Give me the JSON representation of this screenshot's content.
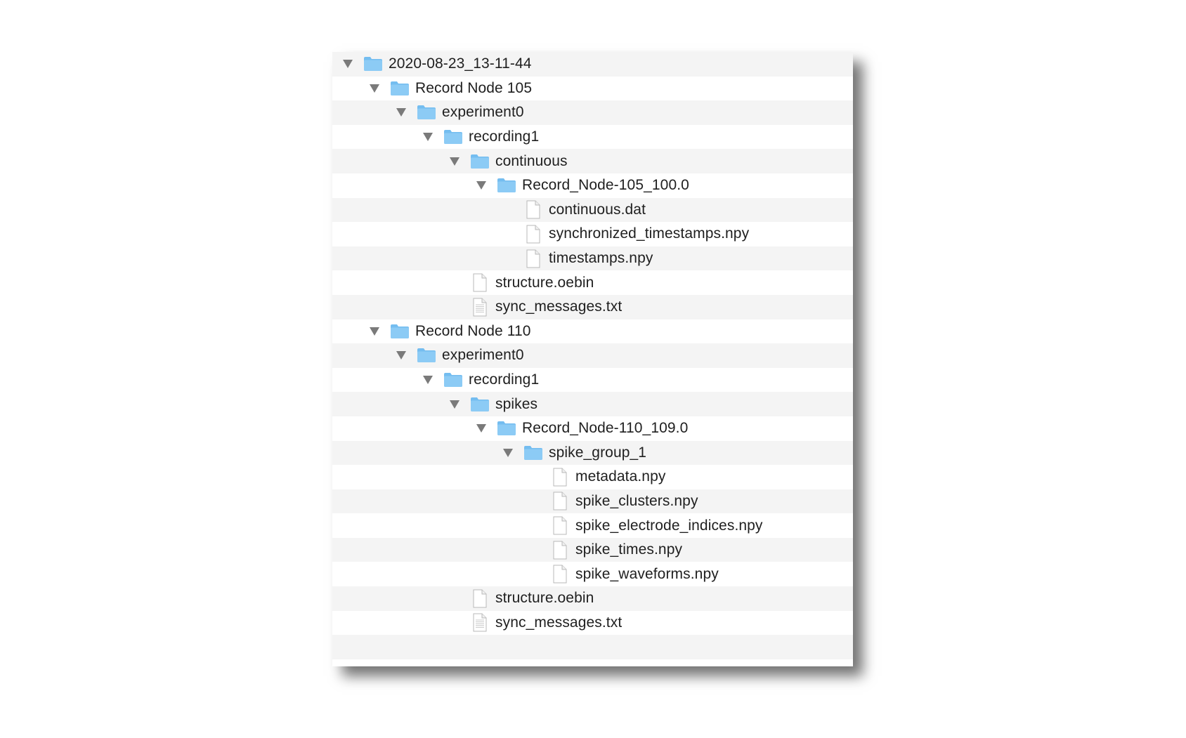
{
  "tree": {
    "rows": [
      {
        "label": "2020-08-23_13-11-44",
        "kind": "folder",
        "depth": 0,
        "expanded": true
      },
      {
        "label": "Record Node 105",
        "kind": "folder",
        "depth": 1,
        "expanded": true
      },
      {
        "label": "experiment0",
        "kind": "folder",
        "depth": 2,
        "expanded": true
      },
      {
        "label": "recording1",
        "kind": "folder",
        "depth": 3,
        "expanded": true
      },
      {
        "label": "continuous",
        "kind": "folder",
        "depth": 4,
        "expanded": true
      },
      {
        "label": "Record_Node-105_100.0",
        "kind": "folder",
        "depth": 5,
        "expanded": true
      },
      {
        "label": "continuous.dat",
        "kind": "file",
        "depth": 6
      },
      {
        "label": "synchronized_timestamps.npy",
        "kind": "file",
        "depth": 6
      },
      {
        "label": "timestamps.npy",
        "kind": "file",
        "depth": 6
      },
      {
        "label": "structure.oebin",
        "kind": "file",
        "depth": 4
      },
      {
        "label": "sync_messages.txt",
        "kind": "text-file",
        "depth": 4
      },
      {
        "label": "Record Node 110",
        "kind": "folder",
        "depth": 1,
        "expanded": true
      },
      {
        "label": "experiment0",
        "kind": "folder",
        "depth": 2,
        "expanded": true
      },
      {
        "label": "recording1",
        "kind": "folder",
        "depth": 3,
        "expanded": true
      },
      {
        "label": "spikes",
        "kind": "folder",
        "depth": 4,
        "expanded": true
      },
      {
        "label": "Record_Node-110_109.0",
        "kind": "folder",
        "depth": 5,
        "expanded": true
      },
      {
        "label": "spike_group_1",
        "kind": "folder",
        "depth": 6,
        "expanded": true
      },
      {
        "label": "metadata.npy",
        "kind": "file",
        "depth": 7
      },
      {
        "label": "spike_clusters.npy",
        "kind": "file",
        "depth": 7
      },
      {
        "label": "spike_electrode_indices.npy",
        "kind": "file",
        "depth": 7
      },
      {
        "label": "spike_times.npy",
        "kind": "file",
        "depth": 7
      },
      {
        "label": "spike_waveforms.npy",
        "kind": "file",
        "depth": 7
      },
      {
        "label": "structure.oebin",
        "kind": "file",
        "depth": 4
      },
      {
        "label": "sync_messages.txt",
        "kind": "text-file",
        "depth": 4
      }
    ]
  },
  "icons": {
    "folder": "folder-icon",
    "file": "document-icon",
    "text-file": "text-document-icon",
    "disclosure": "disclosure-triangle-down-icon"
  },
  "colors": {
    "folder_fill": "#8ccbf5",
    "folder_tab": "#74bdf0",
    "stripe": "#f4f4f4",
    "triangle": "#7a7a7a"
  }
}
